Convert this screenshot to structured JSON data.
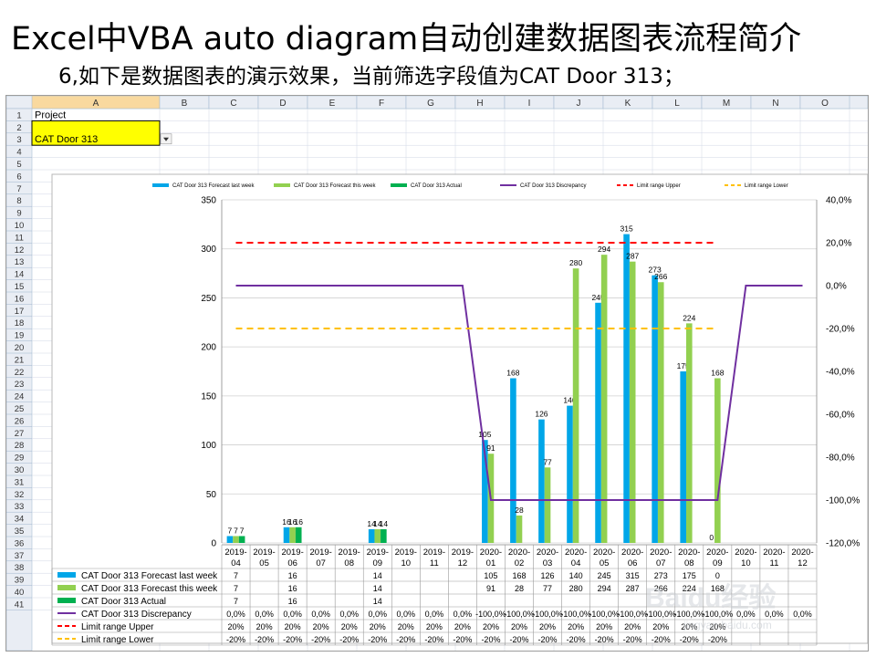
{
  "slide": {
    "title": "Excel中VBA auto diagram自动创建数据图表流程简介",
    "subtitle": "6,如下是数据图表的演示效果，当前筛选字段值为CAT Door 313；"
  },
  "sheet": {
    "columns": [
      "A",
      "B",
      "C",
      "D",
      "E",
      "F",
      "G",
      "H",
      "I",
      "J",
      "K",
      "L",
      "M",
      "N",
      "O"
    ],
    "row_count": 41,
    "a1": "Project",
    "a2": "CAT Door 313",
    "selected_col": "A",
    "watermark": "Baidu经验 jingyan.baidu.com"
  },
  "chart_data": {
    "type": "bar",
    "categories": [
      "2019-04",
      "2019-05",
      "2019-06",
      "2019-07",
      "2019-08",
      "2019-09",
      "2019-10",
      "2019-11",
      "2019-12",
      "2020-01",
      "2020-02",
      "2020-03",
      "2020-04",
      "2020-05",
      "2020-06",
      "2020-07",
      "2020-08",
      "2020-09",
      "2020-10",
      "2020-11",
      "2020-12"
    ],
    "ylim": [
      0,
      350
    ],
    "yticks": [
      "0",
      "50",
      "100",
      "150",
      "200",
      "250",
      "300",
      "350"
    ],
    "y2lim": [
      -120,
      40
    ],
    "y2ticks": [
      "40,0%",
      "20,0%",
      "0,0%",
      "-20,0%",
      "-40,0%",
      "-60,0%",
      "-80,0%",
      "-100,0%",
      "-120,0%"
    ],
    "series": [
      {
        "name": "CAT Door 313 Forecast last week",
        "kind": "bar",
        "color": "#00a6e8",
        "values": [
          7,
          null,
          16,
          null,
          null,
          14,
          null,
          null,
          null,
          105,
          168,
          126,
          140,
          245,
          315,
          273,
          175,
          0,
          null,
          null,
          null
        ],
        "table": [
          "7",
          "",
          "16",
          "",
          "",
          "14",
          "",
          "",
          "",
          "105",
          "168",
          "126",
          "140",
          "245",
          "315",
          "273",
          "175",
          "0",
          "",
          "",
          ""
        ]
      },
      {
        "name": "CAT Door 313 Forecast this week",
        "kind": "bar",
        "color": "#92d050",
        "values": [
          7,
          null,
          16,
          null,
          null,
          14,
          null,
          null,
          null,
          91,
          28,
          77,
          280,
          294,
          287,
          266,
          224,
          168,
          null,
          null,
          null
        ],
        "table": [
          "7",
          "",
          "16",
          "",
          "",
          "14",
          "",
          "",
          "",
          "91",
          "28",
          "77",
          "280",
          "294",
          "287",
          "266",
          "224",
          "168",
          "",
          "",
          ""
        ]
      },
      {
        "name": "CAT Door 313 Actual",
        "kind": "bar",
        "color": "#00b050",
        "values": [
          7,
          null,
          16,
          null,
          null,
          14,
          null,
          null,
          null,
          null,
          null,
          null,
          null,
          null,
          null,
          null,
          null,
          null,
          null,
          null,
          null
        ],
        "table": [
          "7",
          "",
          "16",
          "",
          "",
          "14",
          "",
          "",
          "",
          "",
          "",
          "",
          "",
          "",
          "",
          "",
          "",
          "",
          "",
          "",
          ""
        ]
      },
      {
        "name": "CAT Door 313 Discrepancy",
        "kind": "line",
        "color": "#7030a0",
        "values": [
          0,
          0,
          0,
          0,
          0,
          0,
          0,
          0,
          0,
          -100,
          -100,
          -100,
          -100,
          -100,
          -100,
          -100,
          -100,
          -100,
          0,
          0,
          0
        ],
        "table": [
          "0,0%",
          "0,0%",
          "0,0%",
          "0,0%",
          "0,0%",
          "0,0%",
          "0,0%",
          "0,0%",
          "0,0%",
          "-100,0%",
          "-100,0%",
          "-100,0%",
          "-100,0%",
          "-100,0%",
          "-100,0%",
          "-100,0%",
          "-100,0%",
          "-100,0%",
          "0,0%",
          "0,0%",
          "0,0%"
        ]
      },
      {
        "name": "Limit range Upper",
        "kind": "dash",
        "color": "#ff0000",
        "values": [
          20,
          20,
          20,
          20,
          20,
          20,
          20,
          20,
          20,
          20,
          20,
          20,
          20,
          20,
          20,
          20,
          20,
          20,
          null,
          null,
          null
        ],
        "table": [
          "20%",
          "20%",
          "20%",
          "20%",
          "20%",
          "20%",
          "20%",
          "20%",
          "20%",
          "20%",
          "20%",
          "20%",
          "20%",
          "20%",
          "20%",
          "20%",
          "20%",
          "20%",
          "",
          "",
          ""
        ]
      },
      {
        "name": "Limit range Lower",
        "kind": "dash",
        "color": "#ffc000",
        "values": [
          -20,
          -20,
          -20,
          -20,
          -20,
          -20,
          -20,
          -20,
          -20,
          -20,
          -20,
          -20,
          -20,
          -20,
          -20,
          -20,
          -20,
          -20,
          null,
          null,
          null
        ],
        "table": [
          "-20%",
          "-20%",
          "-20%",
          "-20%",
          "-20%",
          "-20%",
          "-20%",
          "-20%",
          "-20%",
          "-20%",
          "-20%",
          "-20%",
          "-20%",
          "-20%",
          "-20%",
          "-20%",
          "-20%",
          "-20%",
          "",
          "",
          ""
        ]
      }
    ],
    "bar_label_series": [
      "CAT Door 313 Forecast last week",
      "CAT Door 313 Forecast this week",
      "CAT Door 313 Actual"
    ],
    "grid": true,
    "legend": "top"
  }
}
